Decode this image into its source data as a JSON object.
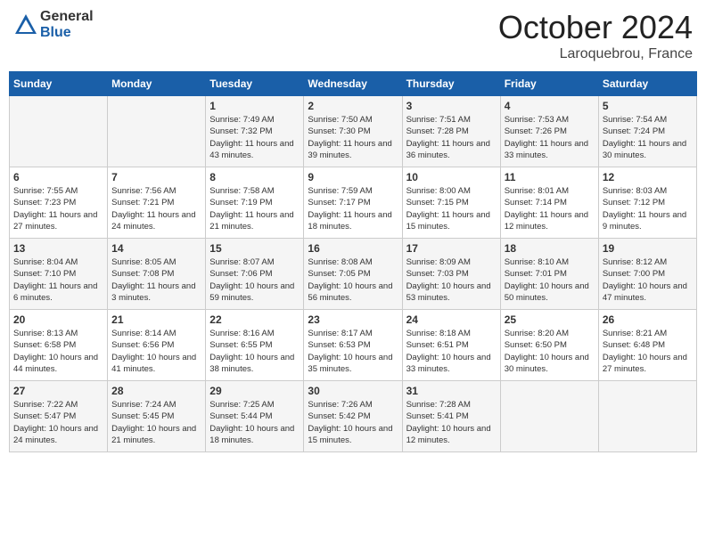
{
  "header": {
    "logo_general": "General",
    "logo_blue": "Blue",
    "month_title": "October 2024",
    "location": "Laroquebrou, France"
  },
  "days_of_week": [
    "Sunday",
    "Monday",
    "Tuesday",
    "Wednesday",
    "Thursday",
    "Friday",
    "Saturday"
  ],
  "weeks": [
    [
      {
        "day": "",
        "sunrise": "",
        "sunset": "",
        "daylight": ""
      },
      {
        "day": "",
        "sunrise": "",
        "sunset": "",
        "daylight": ""
      },
      {
        "day": "1",
        "sunrise": "Sunrise: 7:49 AM",
        "sunset": "Sunset: 7:32 PM",
        "daylight": "Daylight: 11 hours and 43 minutes."
      },
      {
        "day": "2",
        "sunrise": "Sunrise: 7:50 AM",
        "sunset": "Sunset: 7:30 PM",
        "daylight": "Daylight: 11 hours and 39 minutes."
      },
      {
        "day": "3",
        "sunrise": "Sunrise: 7:51 AM",
        "sunset": "Sunset: 7:28 PM",
        "daylight": "Daylight: 11 hours and 36 minutes."
      },
      {
        "day": "4",
        "sunrise": "Sunrise: 7:53 AM",
        "sunset": "Sunset: 7:26 PM",
        "daylight": "Daylight: 11 hours and 33 minutes."
      },
      {
        "day": "5",
        "sunrise": "Sunrise: 7:54 AM",
        "sunset": "Sunset: 7:24 PM",
        "daylight": "Daylight: 11 hours and 30 minutes."
      }
    ],
    [
      {
        "day": "6",
        "sunrise": "Sunrise: 7:55 AM",
        "sunset": "Sunset: 7:23 PM",
        "daylight": "Daylight: 11 hours and 27 minutes."
      },
      {
        "day": "7",
        "sunrise": "Sunrise: 7:56 AM",
        "sunset": "Sunset: 7:21 PM",
        "daylight": "Daylight: 11 hours and 24 minutes."
      },
      {
        "day": "8",
        "sunrise": "Sunrise: 7:58 AM",
        "sunset": "Sunset: 7:19 PM",
        "daylight": "Daylight: 11 hours and 21 minutes."
      },
      {
        "day": "9",
        "sunrise": "Sunrise: 7:59 AM",
        "sunset": "Sunset: 7:17 PM",
        "daylight": "Daylight: 11 hours and 18 minutes."
      },
      {
        "day": "10",
        "sunrise": "Sunrise: 8:00 AM",
        "sunset": "Sunset: 7:15 PM",
        "daylight": "Daylight: 11 hours and 15 minutes."
      },
      {
        "day": "11",
        "sunrise": "Sunrise: 8:01 AM",
        "sunset": "Sunset: 7:14 PM",
        "daylight": "Daylight: 11 hours and 12 minutes."
      },
      {
        "day": "12",
        "sunrise": "Sunrise: 8:03 AM",
        "sunset": "Sunset: 7:12 PM",
        "daylight": "Daylight: 11 hours and 9 minutes."
      }
    ],
    [
      {
        "day": "13",
        "sunrise": "Sunrise: 8:04 AM",
        "sunset": "Sunset: 7:10 PM",
        "daylight": "Daylight: 11 hours and 6 minutes."
      },
      {
        "day": "14",
        "sunrise": "Sunrise: 8:05 AM",
        "sunset": "Sunset: 7:08 PM",
        "daylight": "Daylight: 11 hours and 3 minutes."
      },
      {
        "day": "15",
        "sunrise": "Sunrise: 8:07 AM",
        "sunset": "Sunset: 7:06 PM",
        "daylight": "Daylight: 10 hours and 59 minutes."
      },
      {
        "day": "16",
        "sunrise": "Sunrise: 8:08 AM",
        "sunset": "Sunset: 7:05 PM",
        "daylight": "Daylight: 10 hours and 56 minutes."
      },
      {
        "day": "17",
        "sunrise": "Sunrise: 8:09 AM",
        "sunset": "Sunset: 7:03 PM",
        "daylight": "Daylight: 10 hours and 53 minutes."
      },
      {
        "day": "18",
        "sunrise": "Sunrise: 8:10 AM",
        "sunset": "Sunset: 7:01 PM",
        "daylight": "Daylight: 10 hours and 50 minutes."
      },
      {
        "day": "19",
        "sunrise": "Sunrise: 8:12 AM",
        "sunset": "Sunset: 7:00 PM",
        "daylight": "Daylight: 10 hours and 47 minutes."
      }
    ],
    [
      {
        "day": "20",
        "sunrise": "Sunrise: 8:13 AM",
        "sunset": "Sunset: 6:58 PM",
        "daylight": "Daylight: 10 hours and 44 minutes."
      },
      {
        "day": "21",
        "sunrise": "Sunrise: 8:14 AM",
        "sunset": "Sunset: 6:56 PM",
        "daylight": "Daylight: 10 hours and 41 minutes."
      },
      {
        "day": "22",
        "sunrise": "Sunrise: 8:16 AM",
        "sunset": "Sunset: 6:55 PM",
        "daylight": "Daylight: 10 hours and 38 minutes."
      },
      {
        "day": "23",
        "sunrise": "Sunrise: 8:17 AM",
        "sunset": "Sunset: 6:53 PM",
        "daylight": "Daylight: 10 hours and 35 minutes."
      },
      {
        "day": "24",
        "sunrise": "Sunrise: 8:18 AM",
        "sunset": "Sunset: 6:51 PM",
        "daylight": "Daylight: 10 hours and 33 minutes."
      },
      {
        "day": "25",
        "sunrise": "Sunrise: 8:20 AM",
        "sunset": "Sunset: 6:50 PM",
        "daylight": "Daylight: 10 hours and 30 minutes."
      },
      {
        "day": "26",
        "sunrise": "Sunrise: 8:21 AM",
        "sunset": "Sunset: 6:48 PM",
        "daylight": "Daylight: 10 hours and 27 minutes."
      }
    ],
    [
      {
        "day": "27",
        "sunrise": "Sunrise: 7:22 AM",
        "sunset": "Sunset: 5:47 PM",
        "daylight": "Daylight: 10 hours and 24 minutes."
      },
      {
        "day": "28",
        "sunrise": "Sunrise: 7:24 AM",
        "sunset": "Sunset: 5:45 PM",
        "daylight": "Daylight: 10 hours and 21 minutes."
      },
      {
        "day": "29",
        "sunrise": "Sunrise: 7:25 AM",
        "sunset": "Sunset: 5:44 PM",
        "daylight": "Daylight: 10 hours and 18 minutes."
      },
      {
        "day": "30",
        "sunrise": "Sunrise: 7:26 AM",
        "sunset": "Sunset: 5:42 PM",
        "daylight": "Daylight: 10 hours and 15 minutes."
      },
      {
        "day": "31",
        "sunrise": "Sunrise: 7:28 AM",
        "sunset": "Sunset: 5:41 PM",
        "daylight": "Daylight: 10 hours and 12 minutes."
      },
      {
        "day": "",
        "sunrise": "",
        "sunset": "",
        "daylight": ""
      },
      {
        "day": "",
        "sunrise": "",
        "sunset": "",
        "daylight": ""
      }
    ]
  ]
}
